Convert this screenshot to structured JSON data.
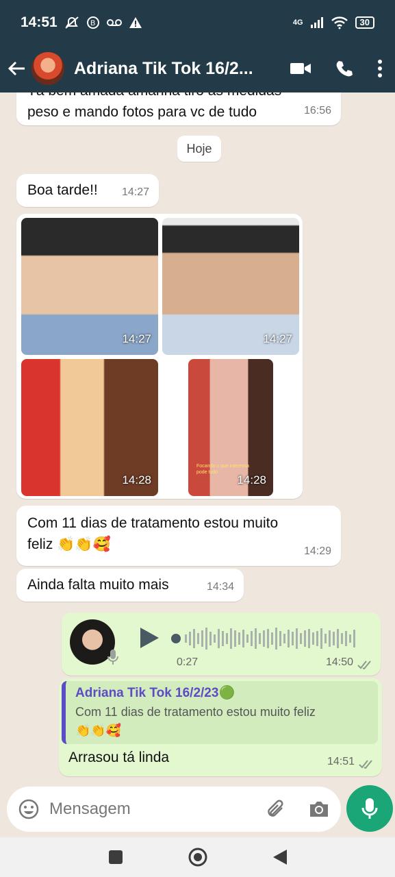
{
  "status": {
    "time": "14:51",
    "network": "4G",
    "battery": "30"
  },
  "header": {
    "contact_name": "Adriana Tik Tok 16/2..."
  },
  "messages": {
    "top_partial": {
      "line1": "Tá bem amada amanhã tiro as medidas",
      "line2": "peso e mando fotos para vc de tudo",
      "time": "16:56"
    },
    "date_label": "Hoje",
    "greeting": {
      "text": "Boa tarde!!",
      "time": "14:27"
    },
    "photos": [
      {
        "time": "14:27"
      },
      {
        "time": "14:27"
      },
      {
        "time": "14:28"
      },
      {
        "time": "14:28",
        "caption": "Focando o que interessa pode tudo"
      }
    ],
    "treatment": {
      "line1": "Com 11 dias de tratamento estou muito",
      "line2": "feliz 👏👏🥰",
      "time": "14:29"
    },
    "more": {
      "text": "Ainda falta muito mais",
      "time": "14:34"
    },
    "voice": {
      "duration": "0:27",
      "time": "14:50"
    },
    "reply": {
      "quoted_name": "Adriana Tik Tok 16/2/23🟢",
      "quoted_text_line1": "Com 11 dias de tratamento estou muito feliz",
      "quoted_text_line2": "👏👏🥰",
      "text": "Arrasou tá linda",
      "time": "14:51"
    }
  },
  "composer": {
    "placeholder": "Mensagem"
  },
  "colors": {
    "header": "#233b48",
    "outgoing": "#e3f8cf",
    "accent": "#1aa677",
    "quote": "#5b4bc4"
  }
}
